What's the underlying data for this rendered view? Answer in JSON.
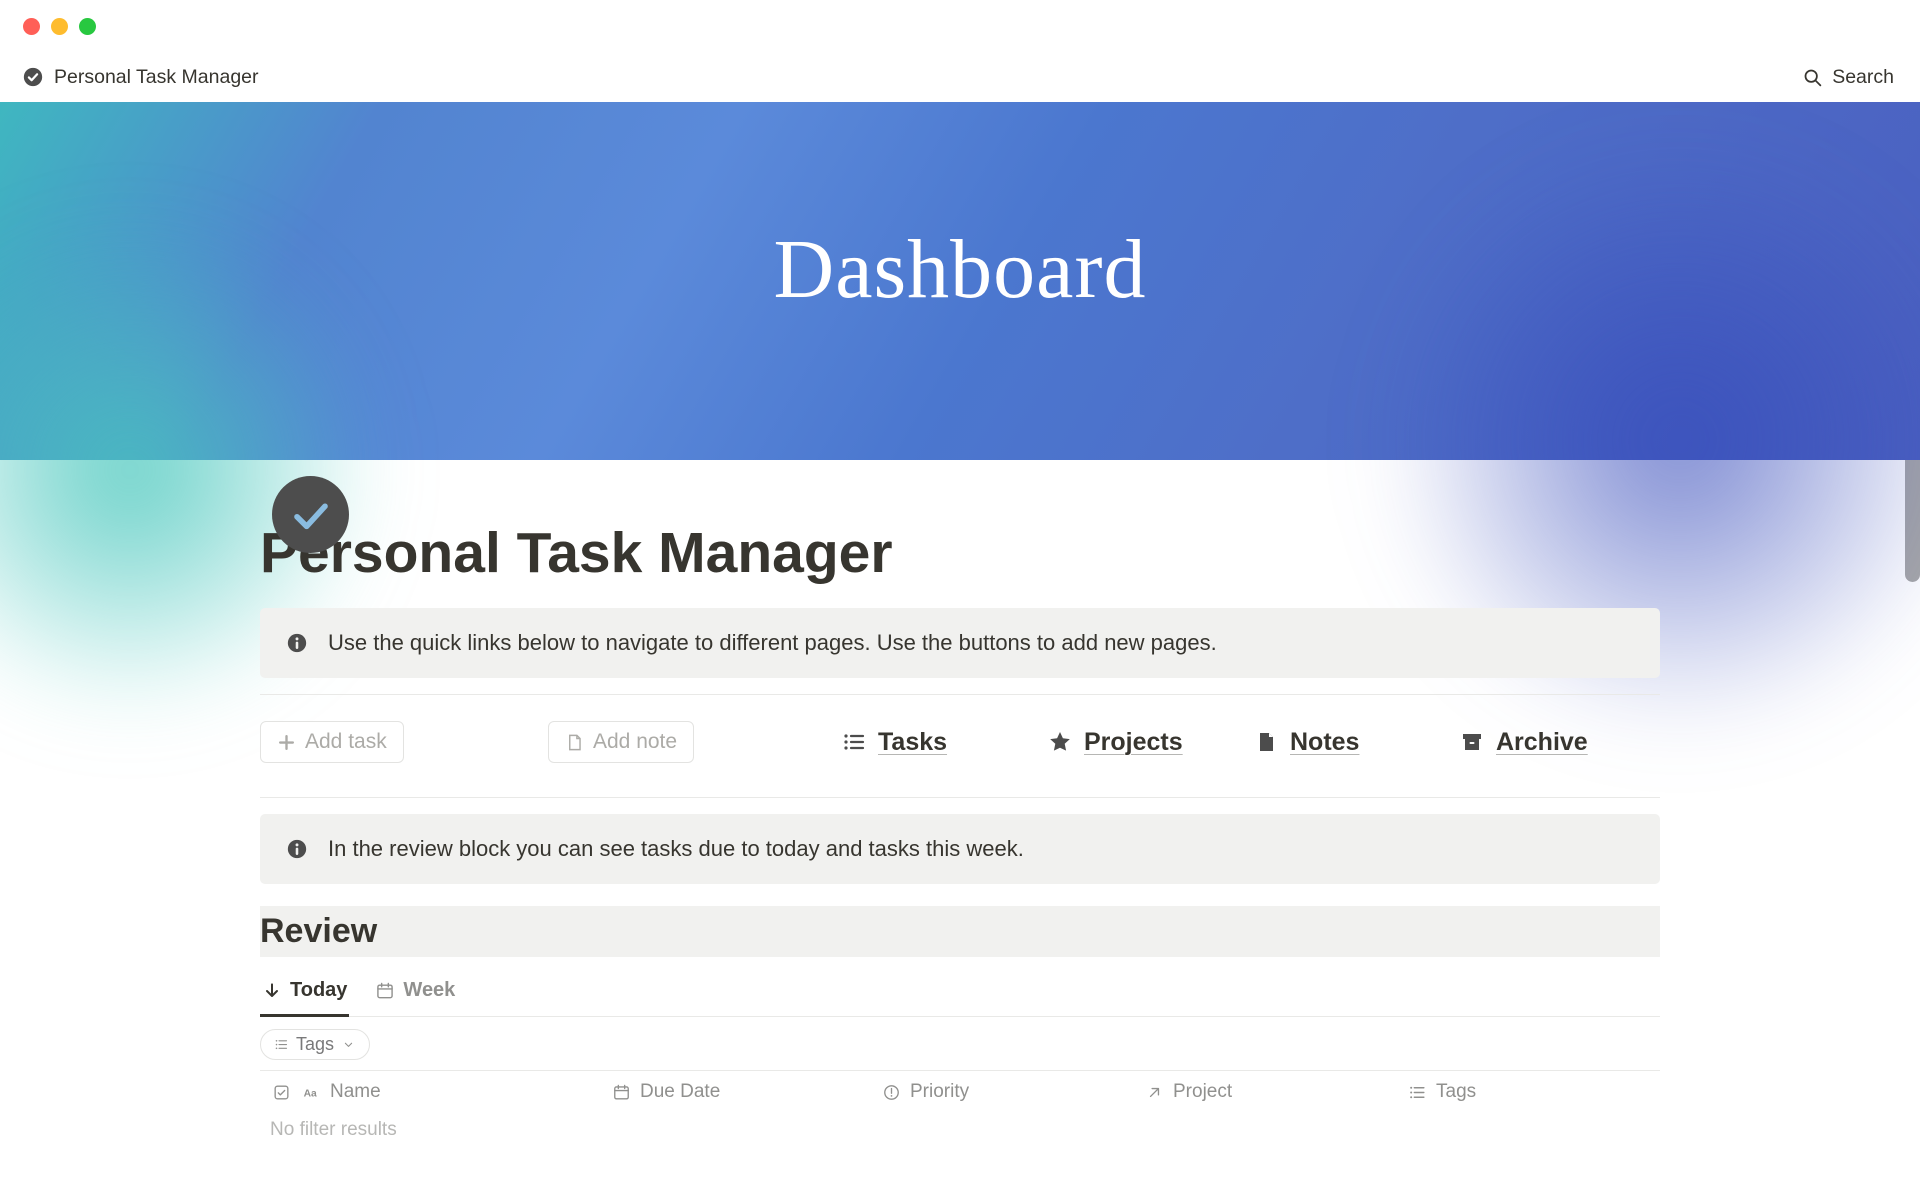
{
  "breadcrumb": {
    "title": "Personal Task Manager"
  },
  "search": {
    "label": "Search"
  },
  "cover": {
    "title": "Dashboard"
  },
  "page": {
    "title": "Personal Task Manager"
  },
  "callouts": {
    "quicklinks": "Use the quick links below to navigate to different pages. Use the buttons to add new pages.",
    "review": "In the review block you can see tasks due to today and tasks this week."
  },
  "buttons": {
    "add_task": "Add task",
    "add_note": "Add note"
  },
  "links": {
    "tasks": "Tasks",
    "projects": "Projects",
    "notes": "Notes",
    "archive": "Archive"
  },
  "review": {
    "heading": "Review",
    "tabs": {
      "today": "Today",
      "week": "Week"
    },
    "filter_tags": "Tags",
    "columns": {
      "name": "Name",
      "due": "Due Date",
      "priority": "Priority",
      "project": "Project",
      "tags": "Tags"
    },
    "empty": "No filter results"
  }
}
